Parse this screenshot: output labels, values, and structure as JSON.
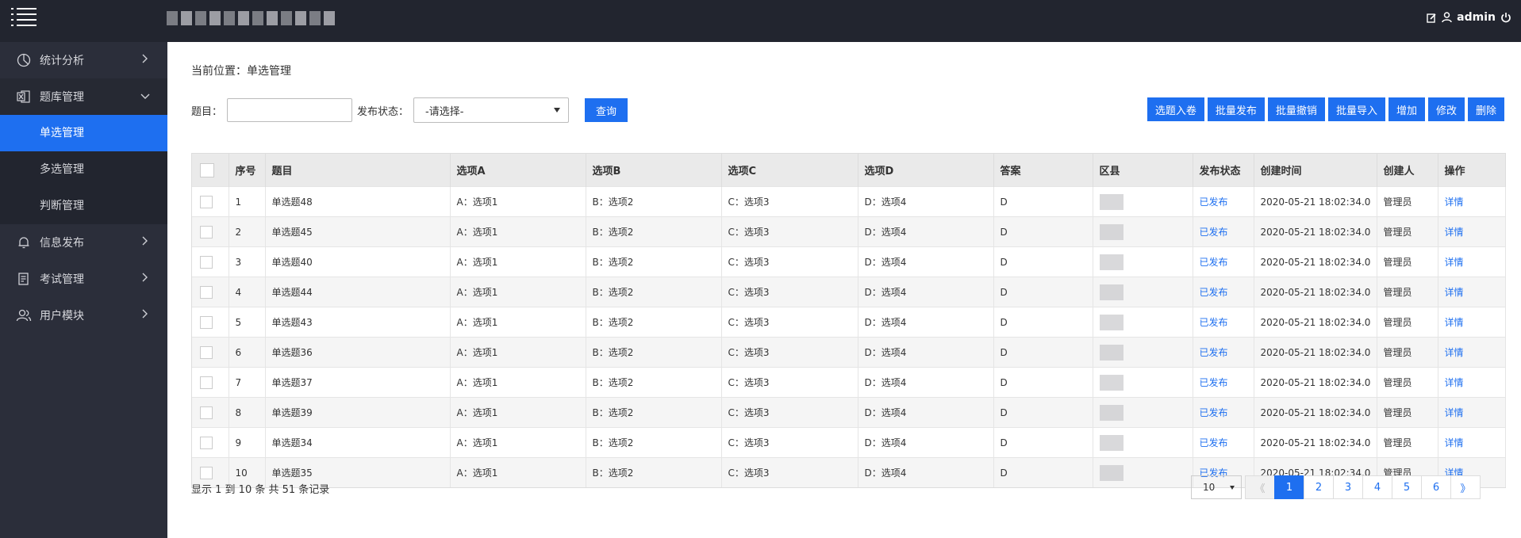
{
  "header": {
    "user_name": "admin"
  },
  "sidebar": {
    "items": [
      {
        "label": "统计分析",
        "icon": "pie-chart-icon"
      },
      {
        "label": "题库管理",
        "icon": "excel-icon"
      },
      {
        "label": "单选管理"
      },
      {
        "label": "多选管理"
      },
      {
        "label": "判断管理"
      },
      {
        "label": "信息发布",
        "icon": "bell-icon"
      },
      {
        "label": "考试管理",
        "icon": "document-icon"
      },
      {
        "label": "用户模块",
        "icon": "users-icon"
      }
    ]
  },
  "breadcrumb": "当前位置：单选管理",
  "filters": {
    "title_label": "题目：",
    "title_value": "",
    "status_label": "发布状态：",
    "status_selected": "-请选择-",
    "search_label": "查询"
  },
  "actions": [
    "选题入卷",
    "批量发布",
    "批量撤销",
    "批量导入",
    "增加",
    "修改",
    "删除"
  ],
  "table": {
    "columns": [
      "序号",
      "题目",
      "选项A",
      "选项B",
      "选项C",
      "选项D",
      "答案",
      "区县",
      "发布状态",
      "创建时间",
      "创建人",
      "操作"
    ],
    "rows": [
      {
        "no": "1",
        "title": "单选题48",
        "a": "A：选项1",
        "b": "B：选项2",
        "c": "C：选项3",
        "d": "D：选项4",
        "answer": "D",
        "status": "已发布",
        "created": "2020-05-21 18:02:34.0",
        "creator": "管理员",
        "op": "详情"
      },
      {
        "no": "2",
        "title": "单选题45",
        "a": "A：选项1",
        "b": "B：选项2",
        "c": "C：选项3",
        "d": "D：选项4",
        "answer": "D",
        "status": "已发布",
        "created": "2020-05-21 18:02:34.0",
        "creator": "管理员",
        "op": "详情"
      },
      {
        "no": "3",
        "title": "单选题40",
        "a": "A：选项1",
        "b": "B：选项2",
        "c": "C：选项3",
        "d": "D：选项4",
        "answer": "D",
        "status": "已发布",
        "created": "2020-05-21 18:02:34.0",
        "creator": "管理员",
        "op": "详情"
      },
      {
        "no": "4",
        "title": "单选题44",
        "a": "A：选项1",
        "b": "B：选项2",
        "c": "C：选项3",
        "d": "D：选项4",
        "answer": "D",
        "status": "已发布",
        "created": "2020-05-21 18:02:34.0",
        "creator": "管理员",
        "op": "详情"
      },
      {
        "no": "5",
        "title": "单选题43",
        "a": "A：选项1",
        "b": "B：选项2",
        "c": "C：选项3",
        "d": "D：选项4",
        "answer": "D",
        "status": "已发布",
        "created": "2020-05-21 18:02:34.0",
        "creator": "管理员",
        "op": "详情"
      },
      {
        "no": "6",
        "title": "单选题36",
        "a": "A：选项1",
        "b": "B：选项2",
        "c": "C：选项3",
        "d": "D：选项4",
        "answer": "D",
        "status": "已发布",
        "created": "2020-05-21 18:02:34.0",
        "creator": "管理员",
        "op": "详情"
      },
      {
        "no": "7",
        "title": "单选题37",
        "a": "A：选项1",
        "b": "B：选项2",
        "c": "C：选项3",
        "d": "D：选项4",
        "answer": "D",
        "status": "已发布",
        "created": "2020-05-21 18:02:34.0",
        "creator": "管理员",
        "op": "详情"
      },
      {
        "no": "8",
        "title": "单选题39",
        "a": "A：选项1",
        "b": "B：选项2",
        "c": "C：选项3",
        "d": "D：选项4",
        "answer": "D",
        "status": "已发布",
        "created": "2020-05-21 18:02:34.0",
        "creator": "管理员",
        "op": "详情"
      },
      {
        "no": "9",
        "title": "单选题34",
        "a": "A：选项1",
        "b": "B：选项2",
        "c": "C：选项3",
        "d": "D：选项4",
        "answer": "D",
        "status": "已发布",
        "created": "2020-05-21 18:02:34.0",
        "creator": "管理员",
        "op": "详情"
      },
      {
        "no": "10",
        "title": "单选题35",
        "a": "A：选项1",
        "b": "B：选项2",
        "c": "C：选项3",
        "d": "D：选项4",
        "answer": "D",
        "status": "已发布",
        "created": "2020-05-21 18:02:34.0",
        "creator": "管理员",
        "op": "详情"
      }
    ]
  },
  "footer": {
    "summary": "显示 1 到 10 条 共 51 条记录",
    "page_size": "10",
    "prev": "《",
    "next": "》",
    "pages": [
      "1",
      "2",
      "3",
      "4",
      "5",
      "6"
    ],
    "current_page": "1"
  },
  "colors": {
    "topbar": "#22252f",
    "sidebar": "#2b2e3a",
    "accent": "#1e6ff0"
  }
}
